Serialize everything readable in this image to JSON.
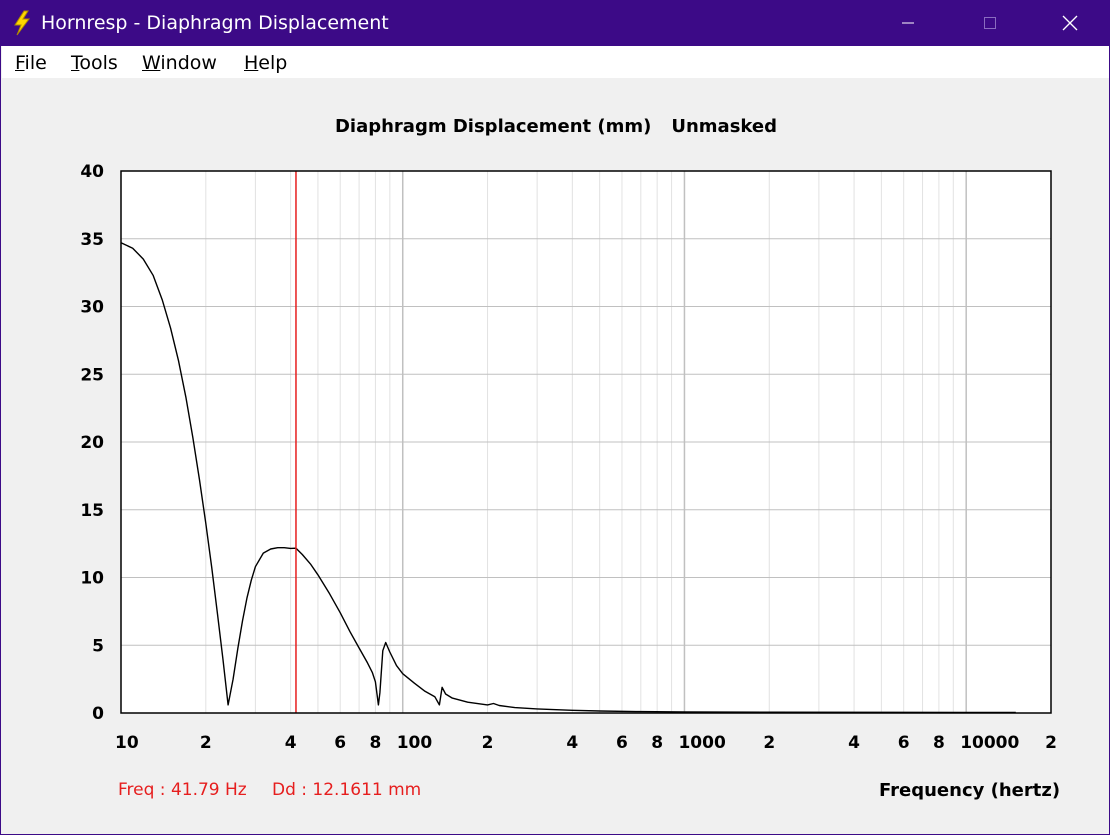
{
  "window": {
    "title": "Hornresp - Diaphragm Displacement",
    "titlebar_color": "#3c0a87"
  },
  "menu": {
    "items": [
      {
        "label": "File",
        "mnemonic": "F",
        "rest": "ile"
      },
      {
        "label": "Tools",
        "mnemonic": "T",
        "rest": "ools"
      },
      {
        "label": "Window",
        "mnemonic": "W",
        "rest": "indow"
      },
      {
        "label": "Help",
        "mnemonic": "H",
        "rest": "elp"
      }
    ]
  },
  "readout": {
    "freq": "Freq : 41.79 Hz",
    "dd": "Dd : 12.1611 mm",
    "color": "#e61e1e"
  },
  "chart_data": {
    "type": "line",
    "title": "Diaphragm Displacement (mm)",
    "subtitle": "Unmasked",
    "xlabel": "Frequency (hertz)",
    "ylabel": "",
    "x_scale": "log",
    "xlim": [
      10,
      20000
    ],
    "ylim": [
      0,
      40
    ],
    "grid": true,
    "y_ticks": [
      "0",
      "5",
      "10",
      "15",
      "20",
      "25",
      "30",
      "35",
      "40"
    ],
    "x_ticks": [
      {
        "v": 10,
        "label": "10"
      },
      {
        "v": 20,
        "label": "2"
      },
      {
        "v": 40,
        "label": "4"
      },
      {
        "v": 60,
        "label": "6"
      },
      {
        "v": 80,
        "label": "8"
      },
      {
        "v": 100,
        "label": "100"
      },
      {
        "v": 200,
        "label": "2"
      },
      {
        "v": 400,
        "label": "4"
      },
      {
        "v": 600,
        "label": "6"
      },
      {
        "v": 800,
        "label": "8"
      },
      {
        "v": 1000,
        "label": "1000"
      },
      {
        "v": 2000,
        "label": "2"
      },
      {
        "v": 4000,
        "label": "4"
      },
      {
        "v": 6000,
        "label": "6"
      },
      {
        "v": 8000,
        "label": "8"
      },
      {
        "v": 10000,
        "label": "10000"
      },
      {
        "v": 20000,
        "label": "2"
      }
    ],
    "marker": {
      "x": 41.79,
      "y": 12.1611,
      "color": "#e61e1e"
    },
    "series": [
      {
        "color": "#000000",
        "points": [
          [
            10,
            34.7
          ],
          [
            11,
            34.3
          ],
          [
            12,
            33.5
          ],
          [
            13,
            32.3
          ],
          [
            14,
            30.5
          ],
          [
            15,
            28.4
          ],
          [
            16,
            26.0
          ],
          [
            17,
            23.3
          ],
          [
            18,
            20.3
          ],
          [
            19,
            17.2
          ],
          [
            20,
            14.0
          ],
          [
            21,
            10.7
          ],
          [
            22,
            7.3
          ],
          [
            23,
            4.0
          ],
          [
            24,
            0.6
          ],
          [
            25,
            2.5
          ],
          [
            26,
            4.8
          ],
          [
            27,
            6.8
          ],
          [
            28,
            8.5
          ],
          [
            29,
            9.8
          ],
          [
            30,
            10.8
          ],
          [
            32,
            11.8
          ],
          [
            34,
            12.1
          ],
          [
            36,
            12.2
          ],
          [
            38,
            12.2
          ],
          [
            40,
            12.15
          ],
          [
            41.79,
            12.16
          ],
          [
            44,
            11.7
          ],
          [
            47,
            11.0
          ],
          [
            50,
            10.2
          ],
          [
            55,
            8.8
          ],
          [
            60,
            7.4
          ],
          [
            65,
            6.0
          ],
          [
            70,
            4.8
          ],
          [
            75,
            3.7
          ],
          [
            78,
            3.0
          ],
          [
            80,
            2.3
          ],
          [
            82,
            0.6
          ],
          [
            83,
            1.5
          ],
          [
            85,
            4.6
          ],
          [
            87,
            5.2
          ],
          [
            90,
            4.5
          ],
          [
            95,
            3.5
          ],
          [
            100,
            2.9
          ],
          [
            110,
            2.2
          ],
          [
            120,
            1.6
          ],
          [
            130,
            1.2
          ],
          [
            135,
            0.6
          ],
          [
            138,
            1.9
          ],
          [
            142,
            1.4
          ],
          [
            150,
            1.1
          ],
          [
            170,
            0.8
          ],
          [
            200,
            0.6
          ],
          [
            210,
            0.7
          ],
          [
            220,
            0.55
          ],
          [
            250,
            0.4
          ],
          [
            300,
            0.3
          ],
          [
            400,
            0.2
          ],
          [
            500,
            0.15
          ],
          [
            700,
            0.1
          ],
          [
            1000,
            0.08
          ],
          [
            2000,
            0.06
          ],
          [
            5000,
            0.05
          ],
          [
            10000,
            0.04
          ],
          [
            15000,
            0.04
          ]
        ]
      }
    ]
  }
}
